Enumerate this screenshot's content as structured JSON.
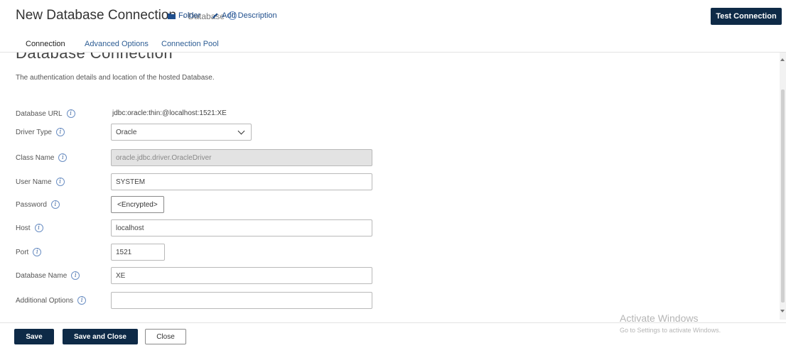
{
  "header": {
    "title": "New Database Connection",
    "subtitle": "- Database",
    "folder_link": "Folder",
    "add_description_link": "Add Description",
    "test_connection": "Test Connection",
    "info_glyph": "i"
  },
  "tabs": [
    {
      "label": "Connection",
      "active": true
    },
    {
      "label": "Advanced Options",
      "active": false
    },
    {
      "label": "Connection Pool",
      "active": false
    }
  ],
  "section": {
    "heading": "Database Connection",
    "description": "The authentication details and location of the hosted Database."
  },
  "form": {
    "database_url": {
      "label": "Database URL",
      "value": "jdbc:oracle:thin:@localhost:1521:XE"
    },
    "driver_type": {
      "label": "Driver Type",
      "value": "Oracle"
    },
    "class_name": {
      "label": "Class Name",
      "value": "oracle.jdbc.driver.OracleDriver"
    },
    "user_name": {
      "label": "User Name",
      "value": "SYSTEM"
    },
    "password": {
      "label": "Password",
      "button": "<Encrypted>"
    },
    "host": {
      "label": "Host",
      "value": "localhost"
    },
    "port": {
      "label": "Port",
      "value": "1521"
    },
    "database_name": {
      "label": "Database Name",
      "value": "XE"
    },
    "additional_options": {
      "label": "Additional Options",
      "value": ""
    }
  },
  "footer": {
    "save": "Save",
    "save_and_close": "Save and Close",
    "close": "Close"
  },
  "watermark": {
    "line1": "Activate Windows",
    "line2": "Go to Settings to activate Windows."
  },
  "colors": {
    "primary_dark": "#0e2a47",
    "link_blue": "#2d5d94",
    "disabled_bg": "#e3e3e3"
  },
  "icons": [
    "info-icon",
    "folder-icon",
    "pencil-icon",
    "chevron-down-icon"
  ]
}
